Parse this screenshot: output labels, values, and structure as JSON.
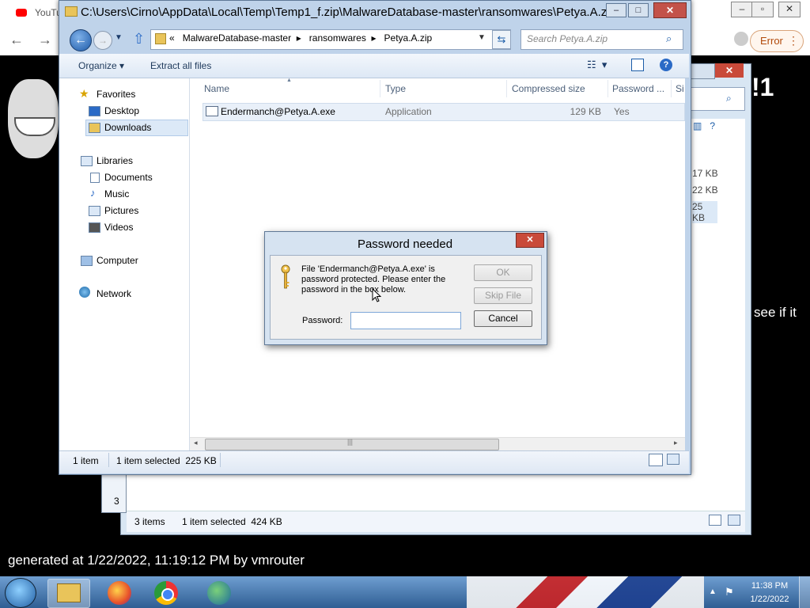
{
  "browser": {
    "tab_label": "YouTu",
    "error_label": "Error"
  },
  "video_overlay": {
    "title_fragment": "!1",
    "caption_fragment": "see if it",
    "generated_text": "generated at 1/22/2022, 11:19:12 PM by vmrouter"
  },
  "back_window": {
    "sizes": [
      "17 KB",
      "22 KB",
      "25 KB"
    ],
    "status_items": "3 items",
    "status_selected": "1 item selected  424 KB",
    "edge_digit": "3"
  },
  "explorer": {
    "title": "C:\\Users\\Cirno\\AppData\\Local\\Temp\\Temp1_f.zip\\MalwareDatabase-master\\ransomwares\\Petya.A.z...",
    "breadcrumb": [
      "«",
      "MalwareDatabase-master",
      "ransomwares",
      "Petya.A.zip"
    ],
    "search_placeholder": "Search Petya.A.zip",
    "toolbar": {
      "organize": "Organize ▾",
      "extract_all": "Extract all files"
    },
    "nav": {
      "favorites": "Favorites",
      "desktop": "Desktop",
      "downloads": "Downloads",
      "libraries": "Libraries",
      "documents": "Documents",
      "music": "Music",
      "pictures": "Pictures",
      "videos": "Videos",
      "computer": "Computer",
      "network": "Network"
    },
    "columns": {
      "name": "Name",
      "type": "Type",
      "compressed_size": "Compressed size",
      "password": "Password ...",
      "size": "Si"
    },
    "rows": [
      {
        "name": "Endermanch@Petya.A.exe",
        "type": "Application",
        "compressed_size": "129 KB",
        "password": "Yes"
      }
    ],
    "status": {
      "items": "1 item",
      "selected": "1 item selected  225 KB"
    }
  },
  "dialog": {
    "title": "Password needed",
    "message": "File 'Endermanch@Petya.A.exe' is password protected.  Please enter the password in the box below.",
    "ok_label": "OK",
    "skip_label": "Skip File",
    "cancel_label": "Cancel",
    "password_label": "Password:",
    "password_value": ""
  },
  "taskbar": {
    "time": "11:38 PM",
    "date": "1/22/2022"
  }
}
